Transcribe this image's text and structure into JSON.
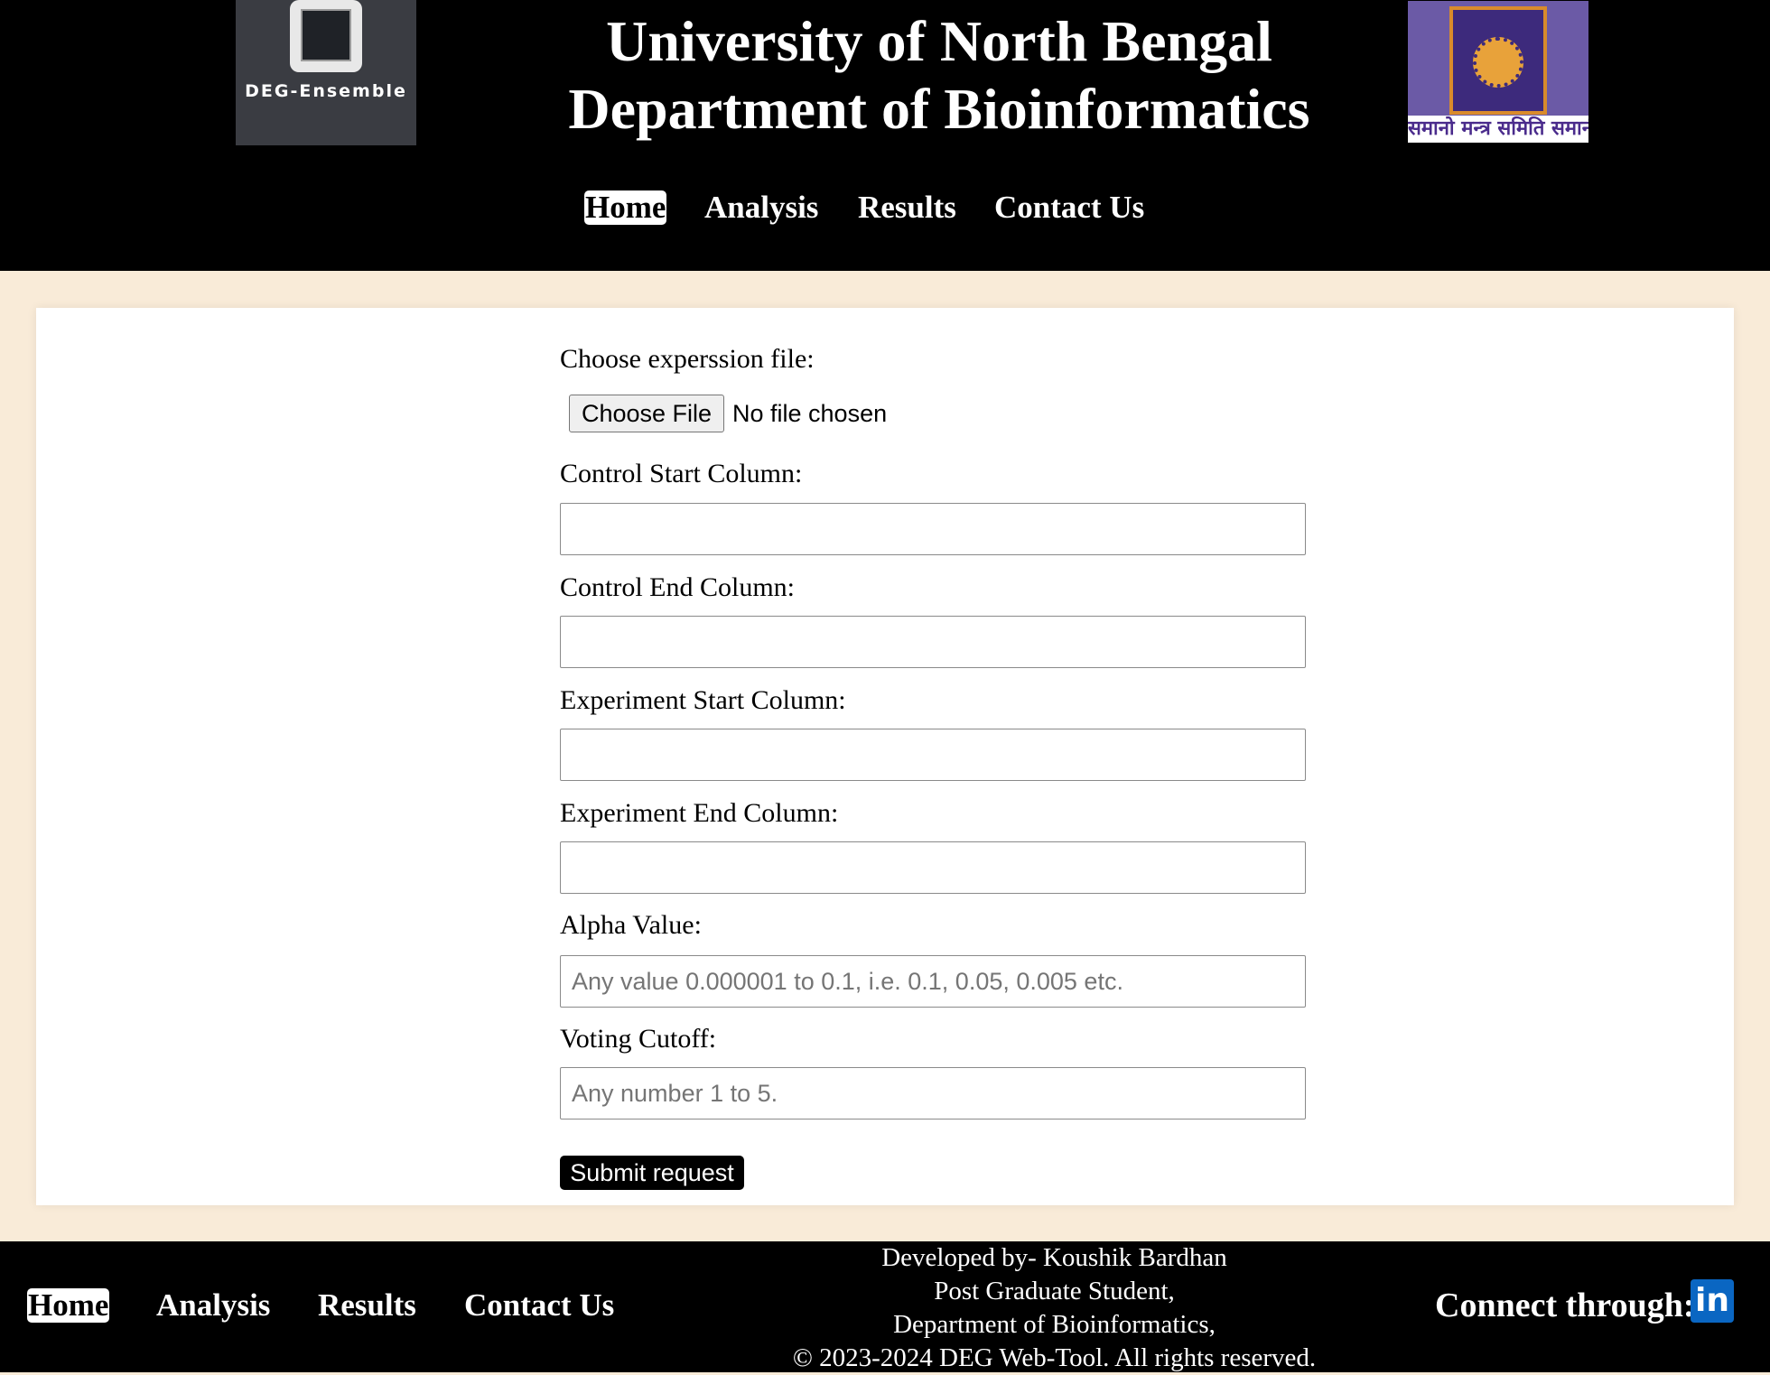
{
  "header": {
    "logo_text": "DEG-Ensemble",
    "title_line1": "University of North Bengal",
    "title_line2": "Department of Bioinformatics",
    "seal_text": "समानो मन्त्र समिति समानी"
  },
  "nav": {
    "items": [
      "Home",
      "Analysis",
      "Results",
      "Contact Us"
    ],
    "active": "Home"
  },
  "form": {
    "file_label": "Choose experssion file:",
    "file_button": "Choose File",
    "file_status": "No file chosen",
    "fields": [
      {
        "label": "Control Start Column:",
        "value": "",
        "placeholder": ""
      },
      {
        "label": "Control End Column:",
        "value": "",
        "placeholder": ""
      },
      {
        "label": "Experiment Start Column:",
        "value": "",
        "placeholder": ""
      },
      {
        "label": "Experiment End Column:",
        "value": "",
        "placeholder": ""
      },
      {
        "label": "Alpha Value:",
        "value": "",
        "placeholder": "Any value 0.000001 to 0.1, i.e. 0.1, 0.05, 0.005 etc."
      },
      {
        "label": "Voting Cutoff:",
        "value": "",
        "placeholder": "Any number 1 to 5."
      }
    ],
    "submit_label": "Submit request"
  },
  "footer": {
    "nav_items": [
      "Home",
      "Analysis",
      "Results",
      "Contact Us"
    ],
    "credits": [
      "Developed by- Koushik Bardhan",
      "Post Graduate Student,",
      "Department of Bioinformatics,",
      "© 2023-2024 DEG Web-Tool. All rights reserved."
    ],
    "connect_label": "Connect through:",
    "linkedin_icon_text": "in"
  },
  "icons": {
    "logo": "deg-ensemble-logo-icon",
    "seal": "university-seal-icon",
    "linkedin": "linkedin-icon"
  },
  "colors": {
    "header_bg": "#000000",
    "page_bg": "#f9ebd8",
    "card_bg": "#ffffff",
    "linkedin": "#0a66c2"
  }
}
